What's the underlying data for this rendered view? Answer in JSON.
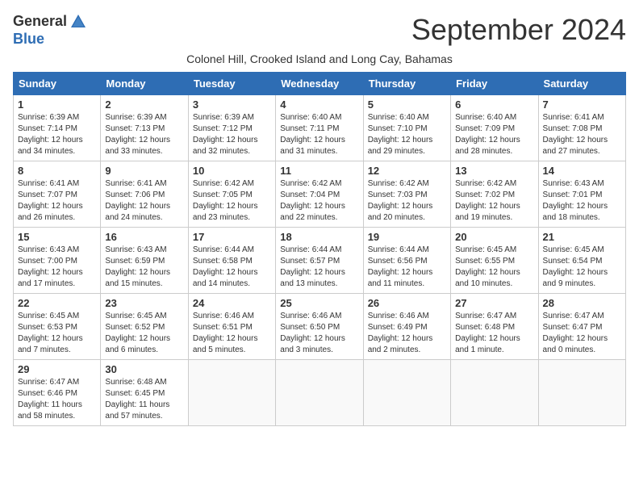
{
  "header": {
    "logo_general": "General",
    "logo_blue": "Blue",
    "month_title": "September 2024",
    "subtitle": "Colonel Hill, Crooked Island and Long Cay, Bahamas"
  },
  "days_of_week": [
    "Sunday",
    "Monday",
    "Tuesday",
    "Wednesday",
    "Thursday",
    "Friday",
    "Saturday"
  ],
  "weeks": [
    [
      {
        "day": 1,
        "sunrise": "6:39 AM",
        "sunset": "7:14 PM",
        "daylight": "12 hours and 34 minutes."
      },
      {
        "day": 2,
        "sunrise": "6:39 AM",
        "sunset": "7:13 PM",
        "daylight": "12 hours and 33 minutes."
      },
      {
        "day": 3,
        "sunrise": "6:39 AM",
        "sunset": "7:12 PM",
        "daylight": "12 hours and 32 minutes."
      },
      {
        "day": 4,
        "sunrise": "6:40 AM",
        "sunset": "7:11 PM",
        "daylight": "12 hours and 31 minutes."
      },
      {
        "day": 5,
        "sunrise": "6:40 AM",
        "sunset": "7:10 PM",
        "daylight": "12 hours and 29 minutes."
      },
      {
        "day": 6,
        "sunrise": "6:40 AM",
        "sunset": "7:09 PM",
        "daylight": "12 hours and 28 minutes."
      },
      {
        "day": 7,
        "sunrise": "6:41 AM",
        "sunset": "7:08 PM",
        "daylight": "12 hours and 27 minutes."
      }
    ],
    [
      {
        "day": 8,
        "sunrise": "6:41 AM",
        "sunset": "7:07 PM",
        "daylight": "12 hours and 26 minutes."
      },
      {
        "day": 9,
        "sunrise": "6:41 AM",
        "sunset": "7:06 PM",
        "daylight": "12 hours and 24 minutes."
      },
      {
        "day": 10,
        "sunrise": "6:42 AM",
        "sunset": "7:05 PM",
        "daylight": "12 hours and 23 minutes."
      },
      {
        "day": 11,
        "sunrise": "6:42 AM",
        "sunset": "7:04 PM",
        "daylight": "12 hours and 22 minutes."
      },
      {
        "day": 12,
        "sunrise": "6:42 AM",
        "sunset": "7:03 PM",
        "daylight": "12 hours and 20 minutes."
      },
      {
        "day": 13,
        "sunrise": "6:42 AM",
        "sunset": "7:02 PM",
        "daylight": "12 hours and 19 minutes."
      },
      {
        "day": 14,
        "sunrise": "6:43 AM",
        "sunset": "7:01 PM",
        "daylight": "12 hours and 18 minutes."
      }
    ],
    [
      {
        "day": 15,
        "sunrise": "6:43 AM",
        "sunset": "7:00 PM",
        "daylight": "12 hours and 17 minutes."
      },
      {
        "day": 16,
        "sunrise": "6:43 AM",
        "sunset": "6:59 PM",
        "daylight": "12 hours and 15 minutes."
      },
      {
        "day": 17,
        "sunrise": "6:44 AM",
        "sunset": "6:58 PM",
        "daylight": "12 hours and 14 minutes."
      },
      {
        "day": 18,
        "sunrise": "6:44 AM",
        "sunset": "6:57 PM",
        "daylight": "12 hours and 13 minutes."
      },
      {
        "day": 19,
        "sunrise": "6:44 AM",
        "sunset": "6:56 PM",
        "daylight": "12 hours and 11 minutes."
      },
      {
        "day": 20,
        "sunrise": "6:45 AM",
        "sunset": "6:55 PM",
        "daylight": "12 hours and 10 minutes."
      },
      {
        "day": 21,
        "sunrise": "6:45 AM",
        "sunset": "6:54 PM",
        "daylight": "12 hours and 9 minutes."
      }
    ],
    [
      {
        "day": 22,
        "sunrise": "6:45 AM",
        "sunset": "6:53 PM",
        "daylight": "12 hours and 7 minutes."
      },
      {
        "day": 23,
        "sunrise": "6:45 AM",
        "sunset": "6:52 PM",
        "daylight": "12 hours and 6 minutes."
      },
      {
        "day": 24,
        "sunrise": "6:46 AM",
        "sunset": "6:51 PM",
        "daylight": "12 hours and 5 minutes."
      },
      {
        "day": 25,
        "sunrise": "6:46 AM",
        "sunset": "6:50 PM",
        "daylight": "12 hours and 3 minutes."
      },
      {
        "day": 26,
        "sunrise": "6:46 AM",
        "sunset": "6:49 PM",
        "daylight": "12 hours and 2 minutes."
      },
      {
        "day": 27,
        "sunrise": "6:47 AM",
        "sunset": "6:48 PM",
        "daylight": "12 hours and 1 minute."
      },
      {
        "day": 28,
        "sunrise": "6:47 AM",
        "sunset": "6:47 PM",
        "daylight": "12 hours and 0 minutes."
      }
    ],
    [
      {
        "day": 29,
        "sunrise": "6:47 AM",
        "sunset": "6:46 PM",
        "daylight": "11 hours and 58 minutes."
      },
      {
        "day": 30,
        "sunrise": "6:48 AM",
        "sunset": "6:45 PM",
        "daylight": "11 hours and 57 minutes."
      },
      null,
      null,
      null,
      null,
      null
    ]
  ]
}
